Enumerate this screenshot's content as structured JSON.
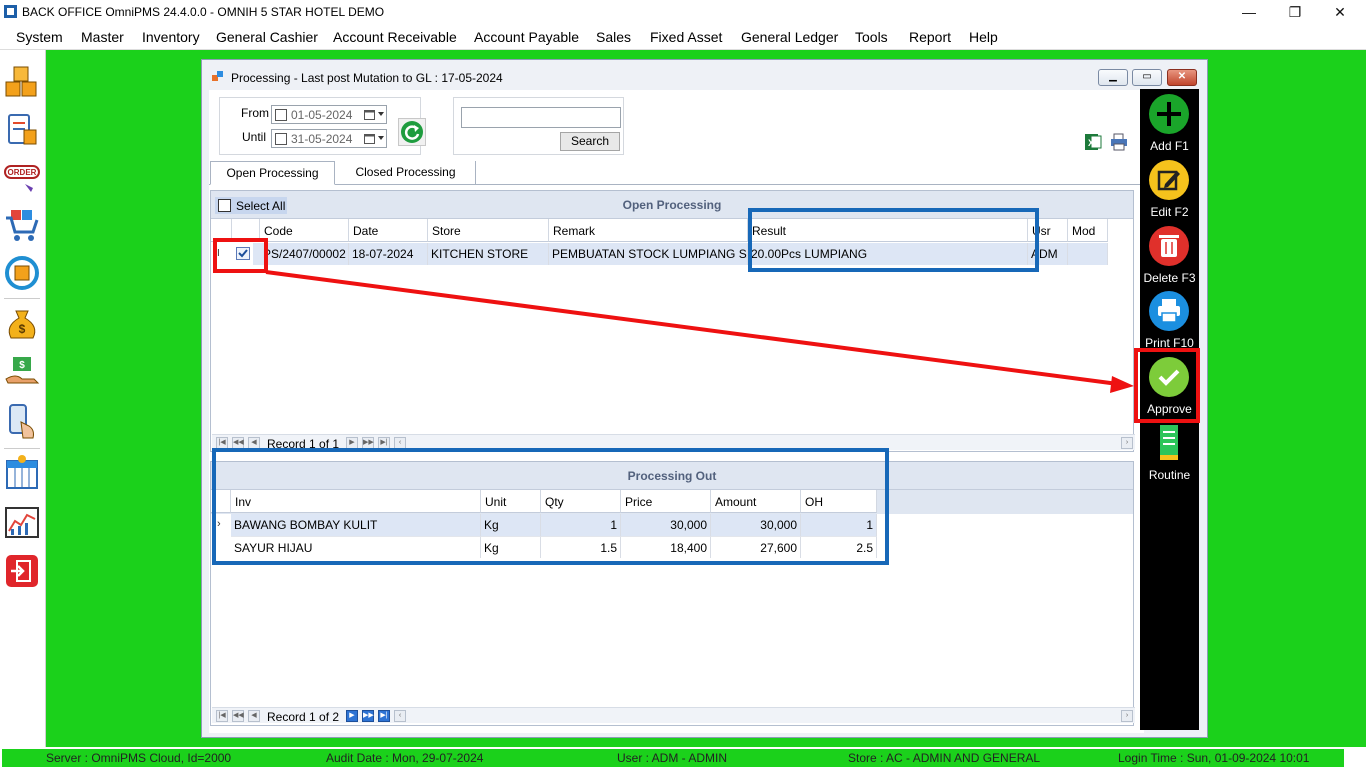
{
  "app": {
    "title": "BACK OFFICE OmniPMS 24.4.0.0 - OMNIH 5 STAR HOTEL DEMO",
    "minimize": "—",
    "restore": "❐",
    "close": "✕"
  },
  "menu": [
    "System",
    "Master",
    "Inventory",
    "General Cashier",
    "Account Receivable",
    "Account Payable",
    "Sales",
    "Fixed Asset",
    "General Ledger",
    "Tools",
    "Report",
    "Help"
  ],
  "left_toolbar": [
    "boxes-icon",
    "clipboard-icon",
    "order-icon",
    "cart-icon",
    "sync-icon",
    "money-bag-icon",
    "hand-money-icon",
    "phone-touch-icon",
    "calendar-icon",
    "chart-icon",
    "exit-icon"
  ],
  "window": {
    "title": "Processing - Last post Mutation to GL : 17-05-2024",
    "from_label": "From",
    "from_value": "01-05-2024",
    "until_label": "Until",
    "until_value": "31-05-2024",
    "search_value": "",
    "search_button": "Search",
    "tabs": [
      "Open Processing",
      "Closed Processing"
    ]
  },
  "open_grid": {
    "select_all": "Select All",
    "caption": "Open Processing",
    "columns": [
      "Code",
      "Date",
      "Store",
      "Remark",
      "Result",
      "Usr",
      "Mod"
    ],
    "row": {
      "indicator": "I",
      "code": "PS/2407/00002",
      "date": "18-07-2024",
      "store": "KITCHEN STORE",
      "remark": "PEMBUATAN STOCK LUMPIANG SAYUR",
      "result": "20.00Pcs LUMPIANG",
      "usr": "ADM",
      "mod": ""
    },
    "record_text": "Record 1 of 1"
  },
  "out_grid": {
    "caption": "Processing Out",
    "columns": [
      "Inv",
      "Unit",
      "Qty",
      "Price",
      "Amount",
      "OH"
    ],
    "rows": [
      {
        "inv": "BAWANG BOMBAY KULIT",
        "unit": "Kg",
        "qty": "1",
        "price": "30,000",
        "amount": "30,000",
        "oh": "1"
      },
      {
        "inv": "SAYUR HIJAU",
        "unit": "Kg",
        "qty": "1.5",
        "price": "18,400",
        "amount": "27,600",
        "oh": "2.5"
      }
    ],
    "record_text": "Record 1 of 2"
  },
  "actions": [
    "Add F1",
    "Edit F2",
    "Delete F3",
    "Print F10",
    "Approve",
    "Routine"
  ],
  "status": {
    "server": "Server : OmniPMS Cloud, Id=2000",
    "audit": "Audit Date : Mon, 29-07-2024",
    "user": "User : ADM - ADMIN",
    "store": "Store : AC - ADMIN AND GENERAL",
    "login": "Login Time : Sun, 01-09-2024 10:01"
  },
  "colors": {
    "desktop_green": "#1bd11b",
    "highlight_red": "#ee1111",
    "highlight_blue": "#1768b8",
    "add_green": "#1aa52a",
    "edit_yellow": "#f5c21c",
    "delete_red": "#e0302b",
    "print_blue": "#1b8fe0",
    "approve_green": "#7dcc3a"
  }
}
